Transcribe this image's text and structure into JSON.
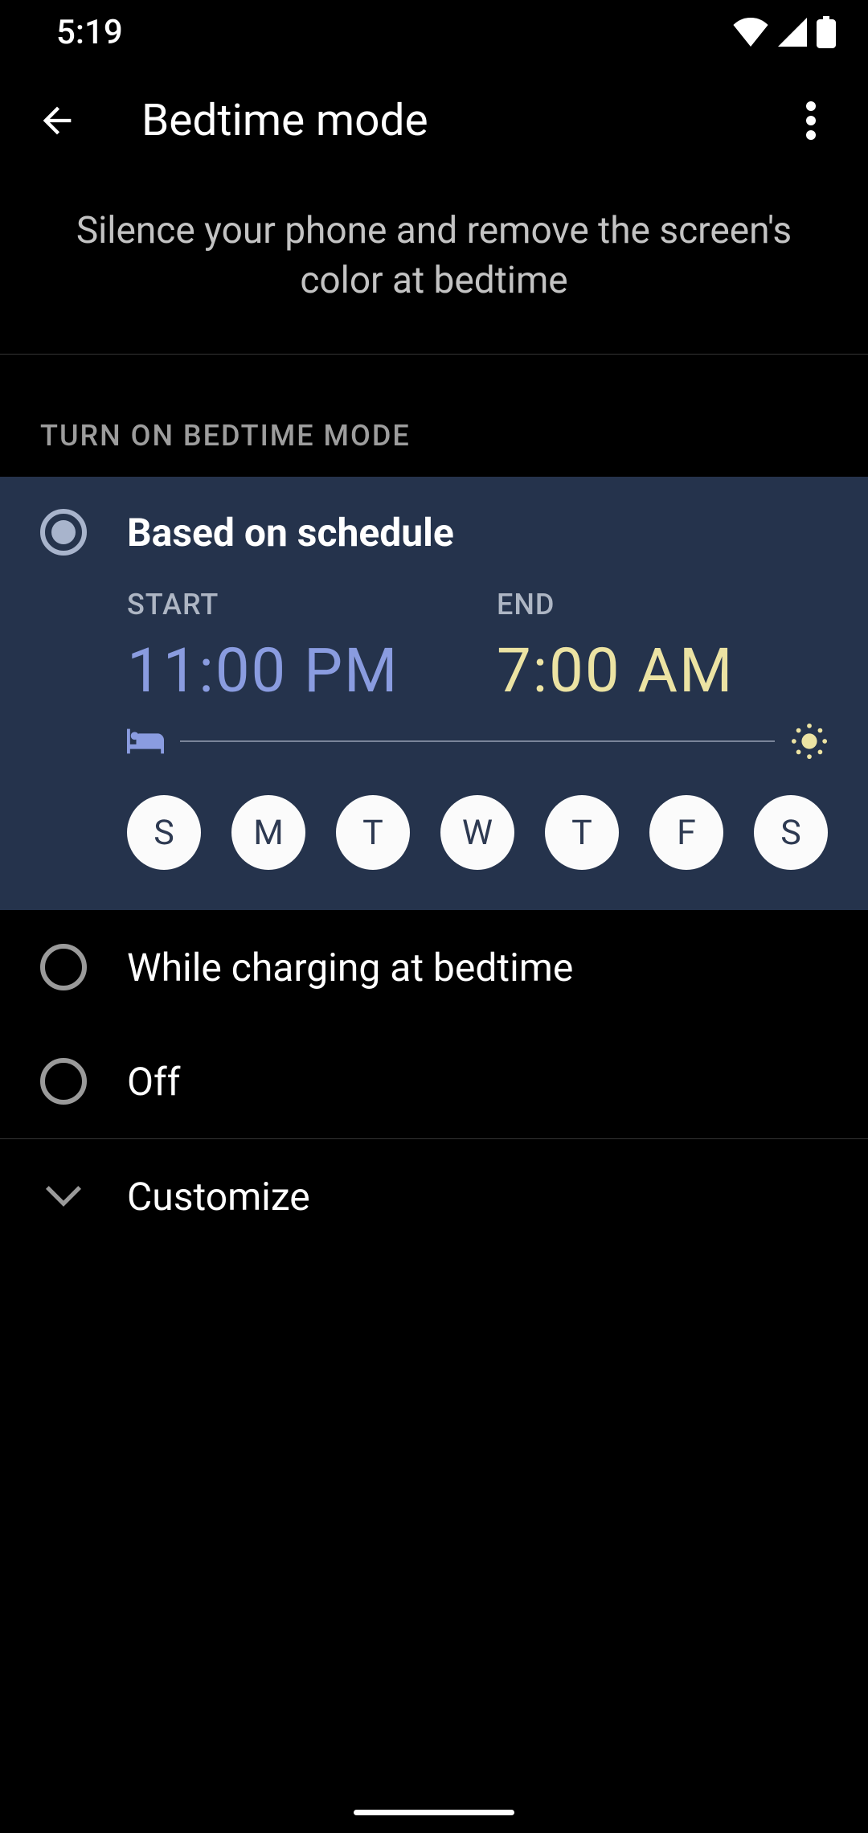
{
  "status": {
    "time": "5:19"
  },
  "header": {
    "title": "Bedtime mode"
  },
  "description": "Silence your phone and remove the screen's color at bedtime",
  "section_header": "TURN ON BEDTIME MODE",
  "schedule": {
    "label": "Based on schedule",
    "start_label": "START",
    "start_time": "11:00 PM",
    "end_label": "END",
    "end_time": "7:00 AM",
    "days": [
      "S",
      "M",
      "T",
      "W",
      "T",
      "F",
      "S"
    ]
  },
  "options": {
    "charging": "While charging at bedtime",
    "off": "Off"
  },
  "customize": "Customize"
}
